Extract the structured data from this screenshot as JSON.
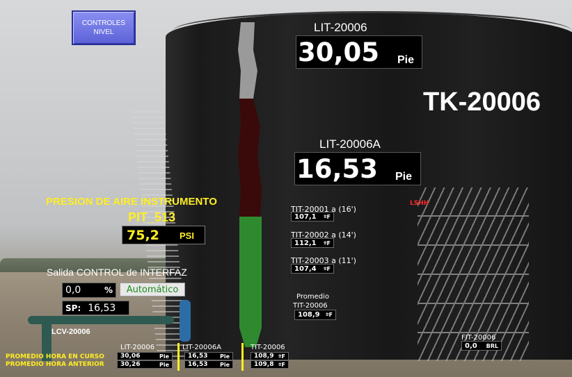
{
  "controls_button": {
    "line1": "CONTROLES",
    "line2": "NIVEL"
  },
  "tank": {
    "title": "TK-20006",
    "lit_main": {
      "tag": "LIT-20006",
      "value": "30,05",
      "unit": "Pie"
    },
    "lit_a": {
      "tag": "LIT-20006A",
      "value": "16,53",
      "unit": "Pie"
    },
    "lshh": "LSHH",
    "gauge_fill_fraction": 0.55
  },
  "air_pressure": {
    "title": "PRESION DE AIRE INSTRUMENTO",
    "tag": "PIT_513",
    "value": "75,2",
    "unit": "PSI"
  },
  "interface_control": {
    "title": "Salida CONTROL de INTERFAZ",
    "output_value": "0,0",
    "output_unit": "%",
    "mode": "Automático",
    "sp_label": "SP:",
    "sp_value": "16,53",
    "valve_tag": "LCV-20006"
  },
  "temperatures": [
    {
      "tag": "TIT-20001 a (16')",
      "value": "107,1",
      "unit": "ºF"
    },
    {
      "tag": "TIT-20002 a (14')",
      "value": "112,1",
      "unit": "ºF"
    },
    {
      "tag": "TIT-20003 a (11')",
      "value": "107,4",
      "unit": "ºF"
    }
  ],
  "temp_average": {
    "label1": "Promedio",
    "label2": "TIT-20006",
    "value": "108,9",
    "unit": "ºF"
  },
  "flow": {
    "tag": "FIT-20006",
    "value": "0,0",
    "unit": "BRL"
  },
  "footer": {
    "row1_label": "PROMEDIO HORA EN CURSO",
    "row2_label": "PROMEDIO HORA ANTERIOR",
    "columns": [
      {
        "tag": "LIT-20006",
        "current": "30,06",
        "previous": "30,26",
        "unit": "Pie"
      },
      {
        "tag": "LIT-20006A",
        "current": "16,53",
        "previous": "16,53",
        "unit": "Pie"
      },
      {
        "tag": "TIT-20006",
        "current": "108,9",
        "previous": "109,8",
        "unit": "ºF"
      }
    ]
  },
  "colors": {
    "accent_yellow": "#ffee22",
    "alarm_red": "#ff2a2a",
    "gauge_green": "#2f8a2f",
    "gauge_red": "#3a0a0a",
    "button_blue": "#5b62d8"
  }
}
